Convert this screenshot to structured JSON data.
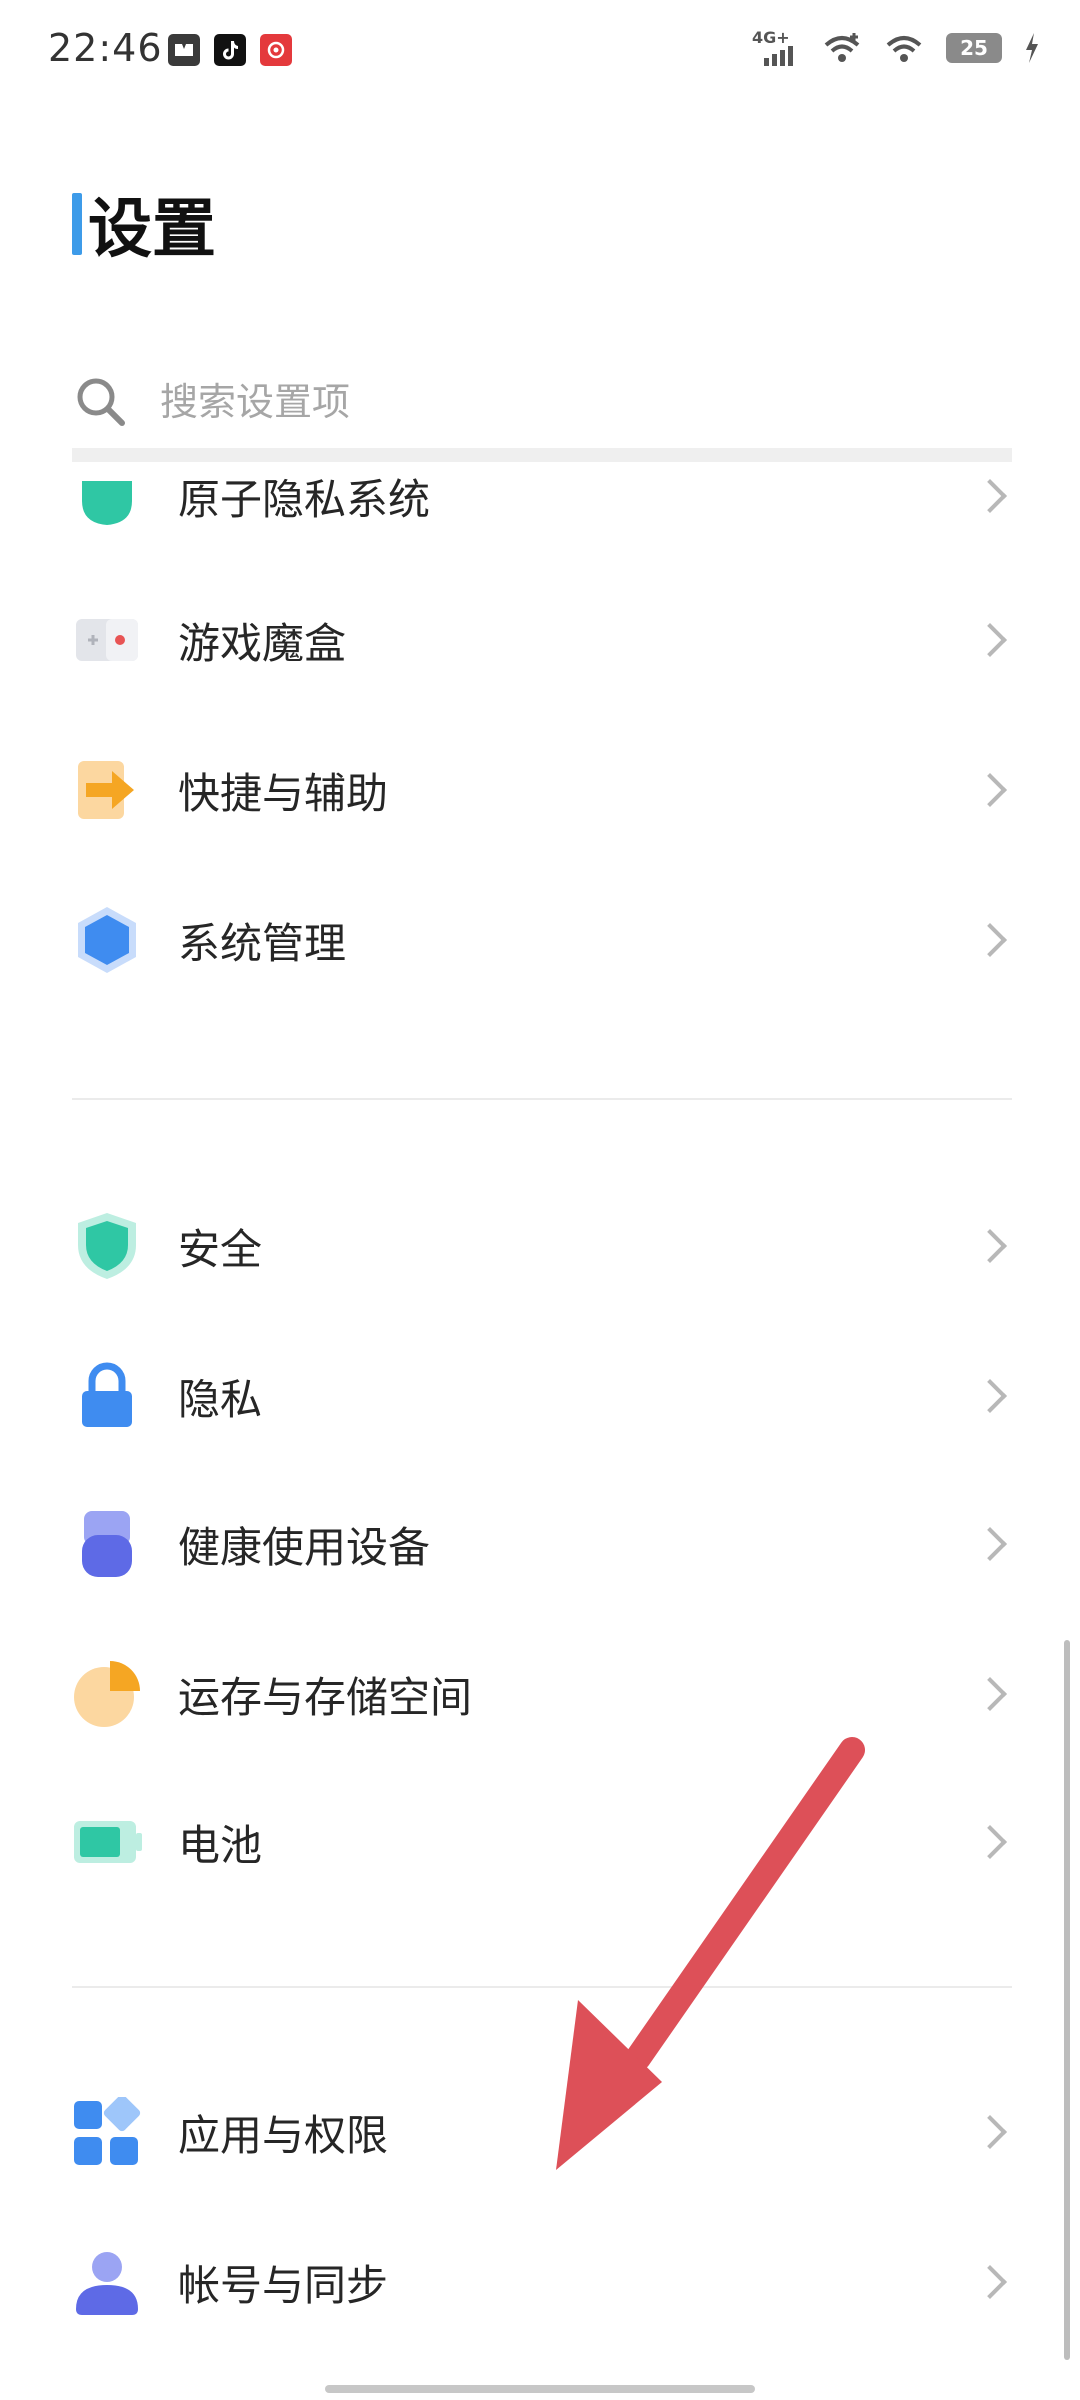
{
  "status_bar": {
    "time": "22:46",
    "network_label": "4G+",
    "battery_level": "25",
    "notification_icons": [
      "messenger-icon",
      "tiktok-icon",
      "netease-music-icon"
    ]
  },
  "header": {
    "title": "设置"
  },
  "search": {
    "placeholder": "搜索设置项"
  },
  "sections": [
    {
      "items": [
        {
          "label": "原子隐私系统",
          "icon": "atom-privacy-icon"
        },
        {
          "label": "游戏魔盒",
          "icon": "game-box-icon"
        },
        {
          "label": "快捷与辅助",
          "icon": "shortcut-arrow-icon"
        },
        {
          "label": "系统管理",
          "icon": "hexagon-system-icon"
        }
      ]
    },
    {
      "items": [
        {
          "label": "安全",
          "icon": "shield-icon"
        },
        {
          "label": "隐私",
          "icon": "lock-icon"
        },
        {
          "label": "健康使用设备",
          "icon": "digital-wellbeing-icon"
        },
        {
          "label": "运存与存储空间",
          "icon": "storage-pie-icon"
        },
        {
          "label": "电池",
          "icon": "battery-icon"
        }
      ]
    },
    {
      "items": [
        {
          "label": "应用与权限",
          "icon": "apps-grid-icon"
        },
        {
          "label": "帐号与同步",
          "icon": "account-person-icon"
        }
      ]
    }
  ],
  "colors": {
    "accent": "#3d9be9",
    "teal": "#2fc7a4",
    "blue": "#3f8cf0",
    "orange": "#f5a623",
    "annotation_arrow": "#dd5058"
  }
}
